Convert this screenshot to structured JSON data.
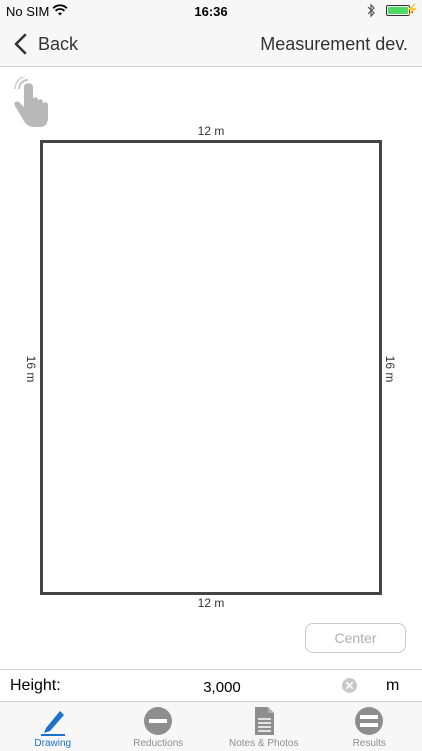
{
  "status_bar": {
    "carrier": "No SIM",
    "time": "16:36",
    "battery_color": "#4cd964"
  },
  "nav": {
    "back_label": "Back",
    "title": "Measurement dev."
  },
  "drawing": {
    "top_dimension": "12 m",
    "bottom_dimension": "12 m",
    "left_dimension": "16 m",
    "right_dimension": "16 m",
    "center_button": "Center",
    "hand_icon": "touch-hand-icon"
  },
  "height": {
    "label": "Height:",
    "value": "3,000",
    "unit": "m"
  },
  "tabs": [
    {
      "label": "Drawing",
      "icon": "pencil-icon",
      "active": true
    },
    {
      "label": "Reductions",
      "icon": "minus-circle-icon",
      "active": false
    },
    {
      "label": "Notes & Photos",
      "icon": "document-icon",
      "active": false
    },
    {
      "label": "Results",
      "icon": "equals-circle-icon",
      "active": false
    }
  ],
  "colors": {
    "accent": "#1a73c9",
    "inactive": "#8e8e8e",
    "room_outline": "#444444"
  }
}
